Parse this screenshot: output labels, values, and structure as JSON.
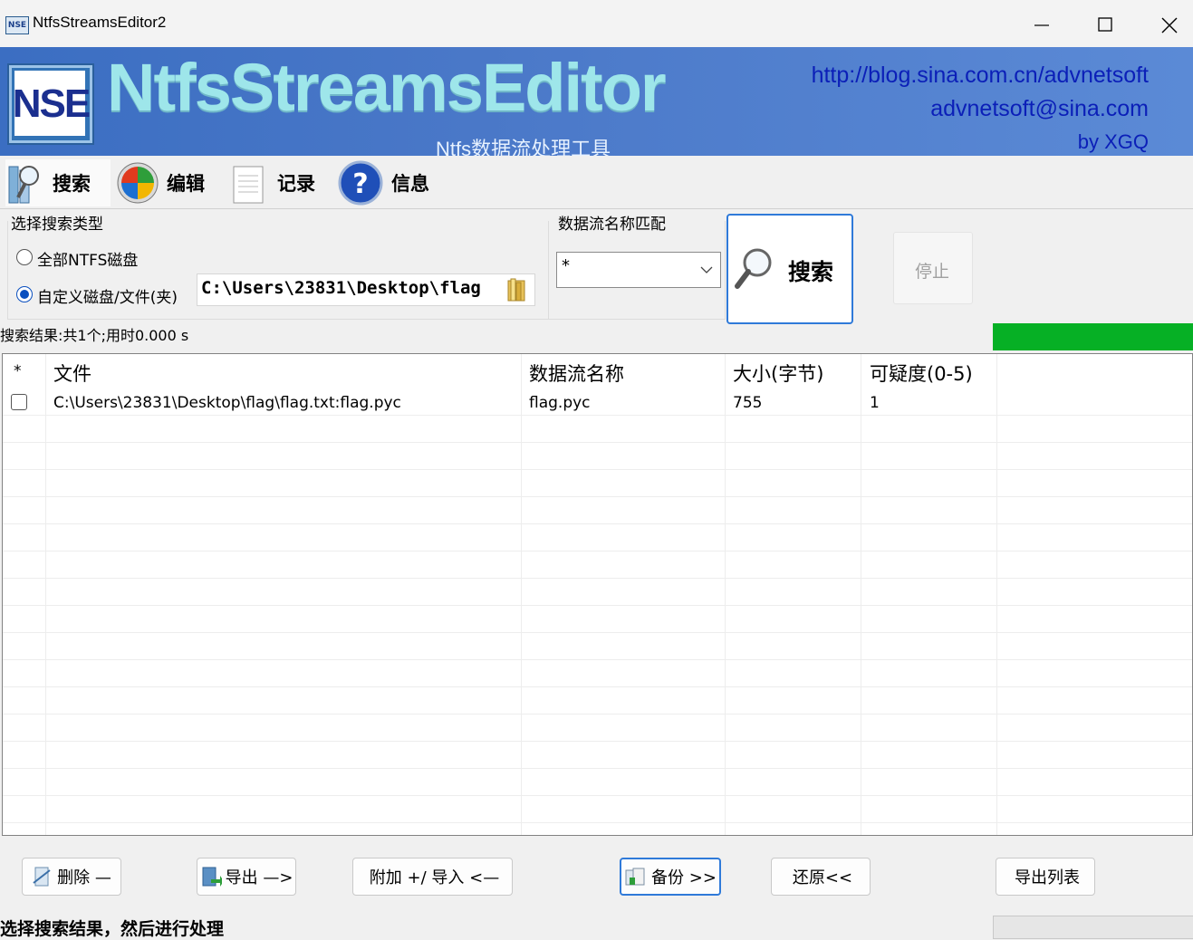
{
  "window": {
    "title": "NtfsStreamsEditor2",
    "icon_text": "NSE"
  },
  "banner": {
    "logo_text": "NSE",
    "brand": "NtfsStreamsEditor",
    "subtitle": "Ntfs数据流处理工具",
    "url": "http://blog.sina.com.cn/advnetsoft",
    "email": "advnetsoft@sina.com",
    "author": "by XGQ"
  },
  "tabs": [
    {
      "label": "搜索",
      "icon": "search-tab-icon",
      "active": true
    },
    {
      "label": "编辑",
      "icon": "edit-tab-icon",
      "active": false
    },
    {
      "label": "记录",
      "icon": "log-tab-icon",
      "active": false
    },
    {
      "label": "信息",
      "icon": "help-icon",
      "active": false
    }
  ],
  "search": {
    "type_group_label": "选择搜索类型",
    "option_all": "全部NTFS磁盘",
    "option_custom": "自定义磁盘/文件(夹)",
    "selected_option": "custom",
    "path_value": "C:\\Users\\23831\\Desktop\\flag",
    "match_label": "数据流名称匹配",
    "match_value": "*",
    "search_button": "搜索",
    "stop_button": "停止"
  },
  "status": {
    "result_text": "搜索结果:共1个;用时0.000 s",
    "progress_fraction": 1.0
  },
  "table": {
    "columns": [
      "*",
      "文件",
      "数据流名称",
      "大小(字节)",
      "可疑度(0-5)"
    ],
    "rows": [
      {
        "checked": false,
        "file": "C:\\Users\\23831\\Desktop\\flag\\flag.txt:flag.pyc",
        "stream": "flag.pyc",
        "size": "755",
        "suspicion": "1"
      }
    ]
  },
  "actions": {
    "delete": "删除 —",
    "export": "导出 —>",
    "append_import": "附加 +/ 导入 <—",
    "backup": "备份 >>",
    "restore": "还原<<",
    "export_list": "导出列表"
  },
  "footer": {
    "hint": "选择搜索结果，然后进行处理"
  },
  "colors": {
    "banner": "#4a78c8",
    "brand_text": "#9ee6ea",
    "link_text": "#0b1fb8",
    "progress": "#06b025",
    "accent": "#2f7ad9"
  }
}
